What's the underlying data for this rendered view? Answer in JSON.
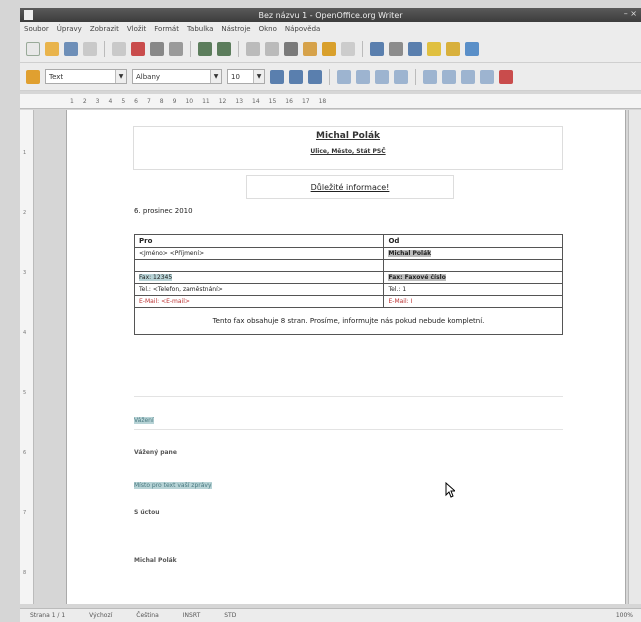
{
  "window": {
    "title": "Bez názvu 1 - OpenOffice.org Writer"
  },
  "menubar": [
    "Soubor",
    "Úpravy",
    "Zobrazit",
    "Vložit",
    "Formát",
    "Tabulka",
    "Nástroje",
    "Okno",
    "Nápověda"
  ],
  "toolbar2": {
    "style": "Text",
    "font": "Albany",
    "size": "10"
  },
  "ruler": [
    "1",
    "2",
    "3",
    "4",
    "5",
    "6",
    "7",
    "8",
    "9",
    "10",
    "11",
    "12",
    "13",
    "14",
    "15",
    "16",
    "17",
    "18"
  ],
  "document": {
    "sender_name": "Michal Polák",
    "sender_address": "Ulice, Město, Stát PSČ",
    "subject": "Důležité informace!",
    "date": "6. prosinec 2010",
    "table": {
      "to_header": "Pro",
      "from_header": "Od",
      "rows": [
        {
          "to": "<Jméno> <Příjmení>",
          "from": "Michal Polák"
        },
        {
          "to": "",
          "from": ""
        },
        {
          "to": "Fax: 12345",
          "from": "Fax: Faxové číslo"
        },
        {
          "to": "Tel.: <Telefon, zaměstnání>",
          "from": "Tel.: 1"
        },
        {
          "to": "E-Mail: <E-mail>",
          "from": "E-Mail: I"
        }
      ],
      "note": "Tento fax obsahuje 8 stran. Prosíme, informujte nás pokud nebude kompletní."
    },
    "salutation": "Vážení",
    "greeting": "Vážený pane",
    "body_placeholder": "Místo pro text vaší zprávy",
    "closing": "S úctou",
    "signature": "Michal Polák"
  },
  "status": {
    "page": "Strana 1 / 1",
    "style": "Výchozí",
    "language": "Čeština",
    "mode": "INSRT",
    "std": "STD",
    "zoom": "100%"
  }
}
